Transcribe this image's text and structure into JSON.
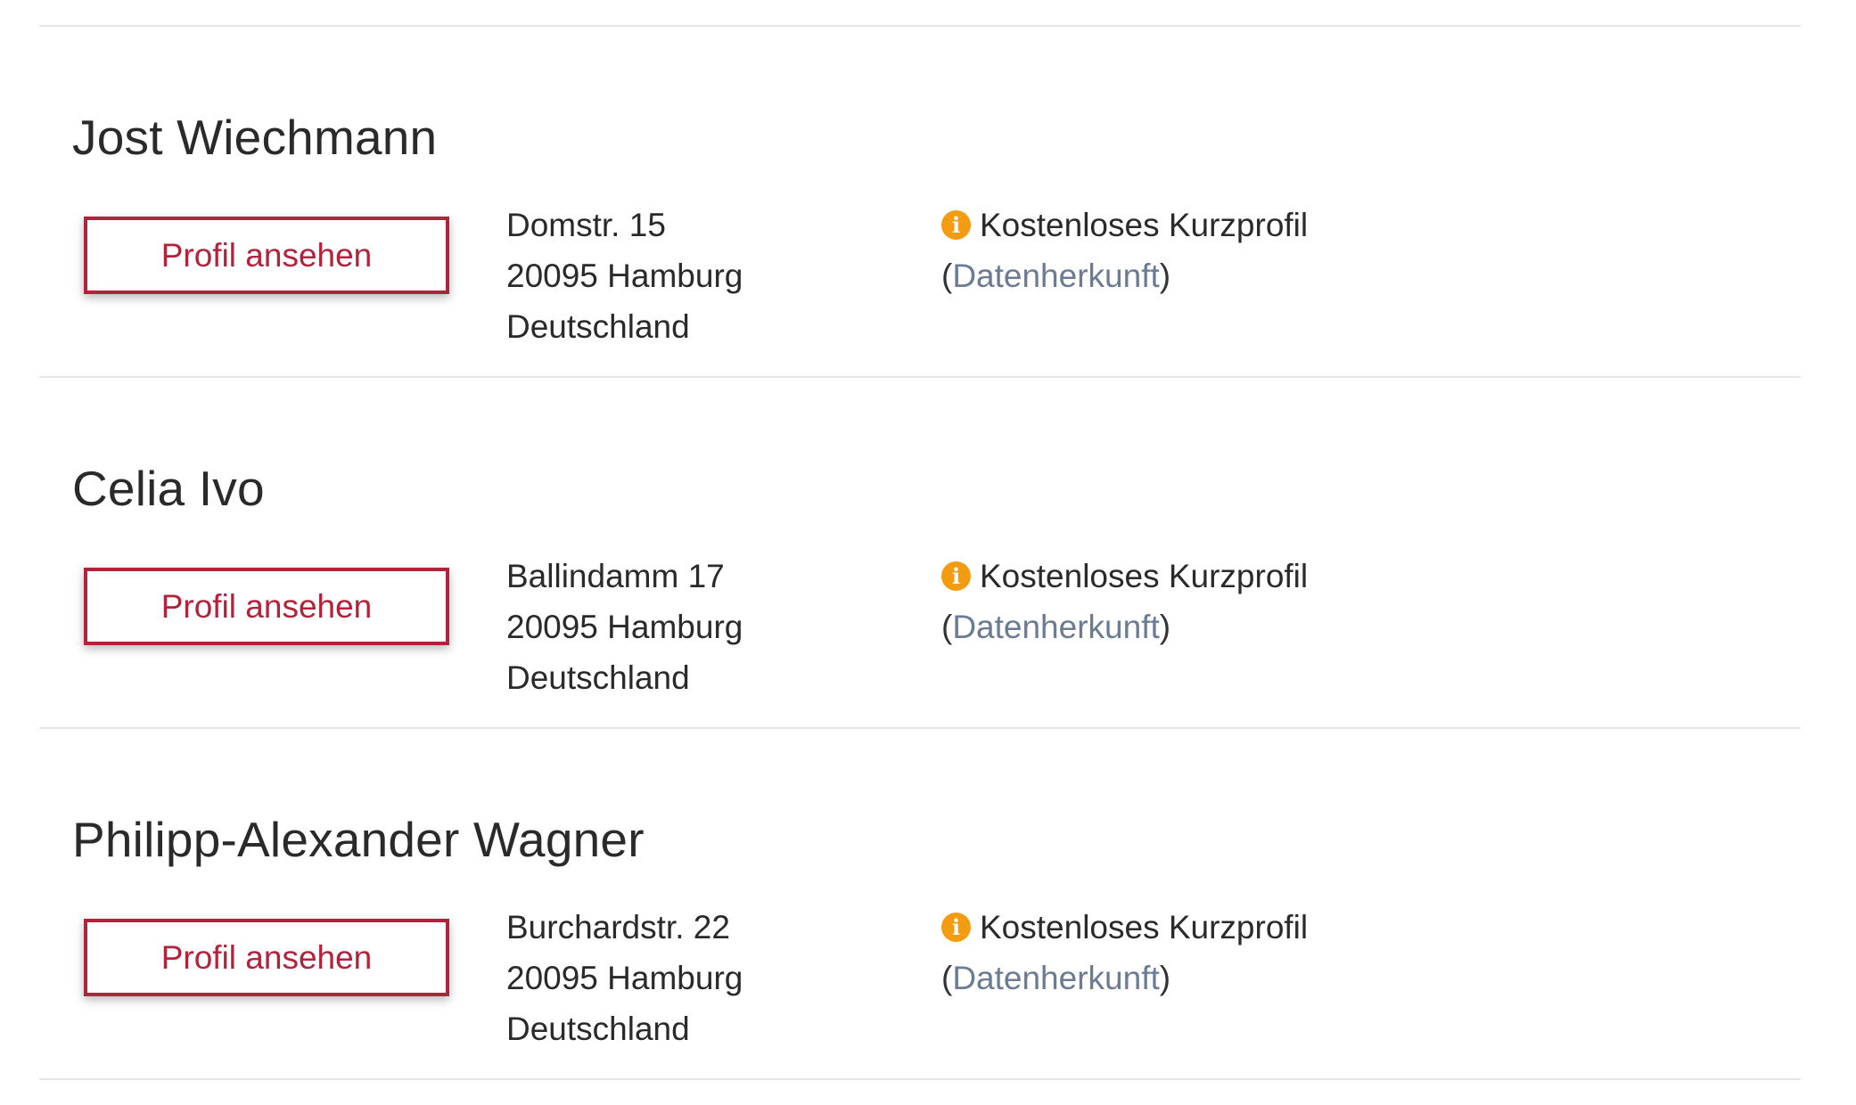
{
  "entries": [
    {
      "name": "Jost Wiechmann",
      "button_label": "Profil ansehen",
      "address": [
        "Domstr. 15",
        "20095 Hamburg",
        "Deutschland"
      ],
      "profile_type": "Kostenloses Kurzprofil",
      "source_link": "Datenherkunft"
    },
    {
      "name": "Celia Ivo",
      "button_label": "Profil ansehen",
      "address": [
        "Ballindamm 17",
        "20095 Hamburg",
        "Deutschland"
      ],
      "profile_type": "Kostenloses Kurzprofil",
      "source_link": "Datenherkunft"
    },
    {
      "name": "Philipp-Alexander Wagner",
      "button_label": "Profil ansehen",
      "address": [
        "Burchardstr. 22",
        "20095 Hamburg",
        "Deutschland"
      ],
      "profile_type": "Kostenloses Kurzprofil",
      "source_link": "Datenherkunft"
    }
  ],
  "icons": {
    "info": "info-circle-icon"
  },
  "colors": {
    "accent": "#b3223a",
    "info_icon": "#f39c12",
    "link": "#6a7b93",
    "divider": "#e6e6e6"
  }
}
